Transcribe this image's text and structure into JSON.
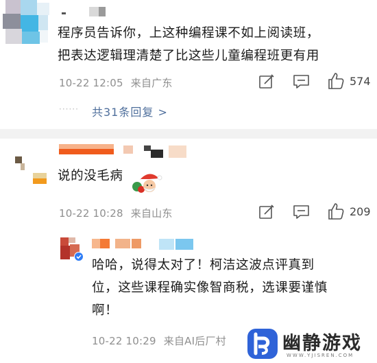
{
  "comment1": {
    "text_line1": "程序员告诉你，上这种编程课不如上阅读班，",
    "text_line2": "把表达逻辑理清楚了比这些儿童编程班更有用",
    "timestamp": "10-22 12:05",
    "location": "来自广东",
    "likes": "574",
    "more_replies": "共31条回复 >",
    "more_replies_dots": "······"
  },
  "comment2": {
    "text": "说的没毛病",
    "timestamp": "10-22 10:28",
    "location": "来自山东",
    "likes": "209"
  },
  "reply": {
    "text_line1": "哈哈，说得太对了！柯洁这波点评真到",
    "text_line2": "位，这些课程确实像智商税，选课要谨慎",
    "text_line3": "啊！",
    "timestamp": "10-22 10:29",
    "location": "来自AI后厂村"
  },
  "watermark": {
    "brand": "幽静游戏",
    "url": "WWW.YJISREN.COM"
  },
  "colors": {
    "accent_blue": "#2f63d8",
    "replies_link": "#4f6f9c",
    "meta_gray": "#8f8f8f"
  },
  "icons": [
    "edit-icon",
    "comment-icon",
    "like-icon",
    "emoji-santa-icon",
    "verified-badge-icon",
    "brand-logo-icon"
  ]
}
